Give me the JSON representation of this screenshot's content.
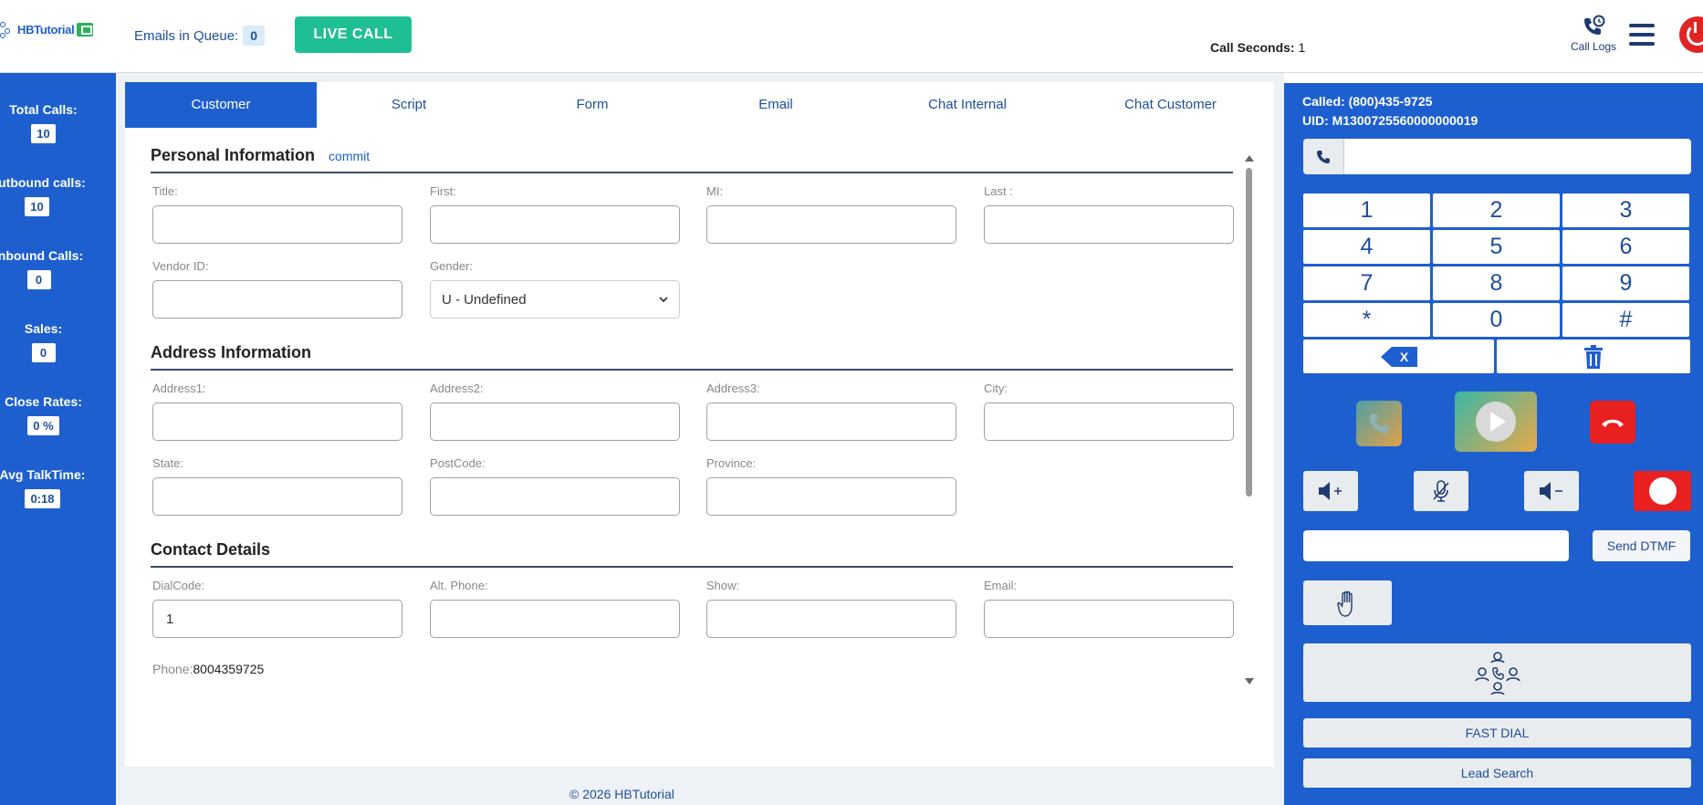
{
  "brand": {
    "name": "HBTutorial"
  },
  "header": {
    "emails_in_queue_label": "Emails in Queue:",
    "emails_in_queue_count": "0",
    "live_call_label": "LIVE CALL",
    "call_seconds_label": "Call Seconds:",
    "call_seconds_value": "1",
    "call_logs_label": "Call Logs",
    "icons": {
      "call_logs": "phone-clock-icon",
      "menu": "hamburger-menu-icon",
      "power": "power-icon"
    }
  },
  "stats": [
    {
      "label": "Total Calls:",
      "value": "10"
    },
    {
      "label": "Outbound calls:",
      "value": "10"
    },
    {
      "label": "Inbound Calls:",
      "value": "0"
    },
    {
      "label": "Sales:",
      "value": "0"
    },
    {
      "label": "Close Rates:",
      "value": "0 %"
    },
    {
      "label": "Avg TalkTime:",
      "value": "0:18"
    }
  ],
  "tabs": [
    {
      "label": "Customer",
      "active": true
    },
    {
      "label": "Script"
    },
    {
      "label": "Form"
    },
    {
      "label": "Email"
    },
    {
      "label": "Chat Internal"
    },
    {
      "label": "Chat Customer"
    }
  ],
  "form": {
    "personal": {
      "title": "Personal Information",
      "commit_label": "commit",
      "fields": {
        "title": {
          "label": "Title:",
          "value": ""
        },
        "first": {
          "label": "First:",
          "value": ""
        },
        "mi": {
          "label": "MI:",
          "value": ""
        },
        "last": {
          "label": "Last :",
          "value": ""
        },
        "vendor_id": {
          "label": "Vendor ID:",
          "value": ""
        },
        "gender": {
          "label": "Gender:",
          "value": "U - Undefined"
        }
      }
    },
    "address": {
      "title": "Address Information",
      "fields": {
        "address1": {
          "label": "Address1:",
          "value": ""
        },
        "address2": {
          "label": "Address2:",
          "value": ""
        },
        "address3": {
          "label": "Address3:",
          "value": ""
        },
        "city": {
          "label": "City:",
          "value": ""
        },
        "state": {
          "label": "State:",
          "value": ""
        },
        "postcode": {
          "label": "PostCode:",
          "value": ""
        },
        "province": {
          "label": "Province:",
          "value": ""
        }
      }
    },
    "contact": {
      "title": "Contact Details",
      "fields": {
        "dialcode": {
          "label": "DialCode:",
          "value": "1"
        },
        "alt_phone": {
          "label": "Alt. Phone:",
          "value": ""
        },
        "show": {
          "label": "Show:",
          "value": ""
        },
        "email": {
          "label": "Email:",
          "value": ""
        }
      },
      "phone_label": "Phone:",
      "phone_value": "8004359725"
    }
  },
  "footer": {
    "text": "© 2026 HBTutorial"
  },
  "dialer": {
    "called": "Called: (800)435-9725",
    "uid": "UID: M1300725560000000019",
    "number_value": "",
    "keys": [
      "1",
      "2",
      "3",
      "4",
      "5",
      "6",
      "7",
      "8",
      "9",
      "*",
      "0",
      "#"
    ],
    "backspace_label": "X",
    "dtmf_value": "",
    "send_dtmf_label": "Send DTMF",
    "fast_dial_label": "FAST DIAL",
    "lead_search_label": "Lead Search",
    "colors": {
      "panel": "#1e5fd0",
      "hangup": "#e82020",
      "record": "#e82020",
      "live_call": "#1fbf95"
    },
    "icons": [
      "phone-icon",
      "call-icon",
      "play-icon",
      "hangup-icon",
      "volume-up-icon",
      "mute-mic-icon",
      "volume-down-icon",
      "record-icon",
      "hand-icon",
      "conference-icon",
      "trash-icon",
      "backspace-icon"
    ]
  }
}
